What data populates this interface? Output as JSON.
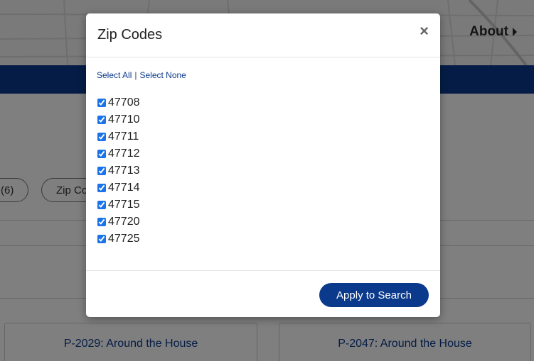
{
  "background": {
    "about_label": "About",
    "pills": [
      "(6)",
      "Zip Co"
    ],
    "cards": [
      "P-2029: Around the House",
      "P-2047: Around the House"
    ],
    "colors": {
      "navbar": "#0b3a8c"
    }
  },
  "modal": {
    "title": "Zip Codes",
    "close_label": "×",
    "select_all": "Select All",
    "separator": "|",
    "select_none": "Select None",
    "zip_codes": [
      {
        "code": "47708",
        "checked": true
      },
      {
        "code": "47710",
        "checked": true
      },
      {
        "code": "47711",
        "checked": true
      },
      {
        "code": "47712",
        "checked": true
      },
      {
        "code": "47713",
        "checked": true
      },
      {
        "code": "47714",
        "checked": true
      },
      {
        "code": "47715",
        "checked": true
      },
      {
        "code": "47720",
        "checked": true
      },
      {
        "code": "47725",
        "checked": true
      }
    ],
    "apply_label": "Apply to Search",
    "colors": {
      "accent": "#0b3a8c"
    }
  }
}
